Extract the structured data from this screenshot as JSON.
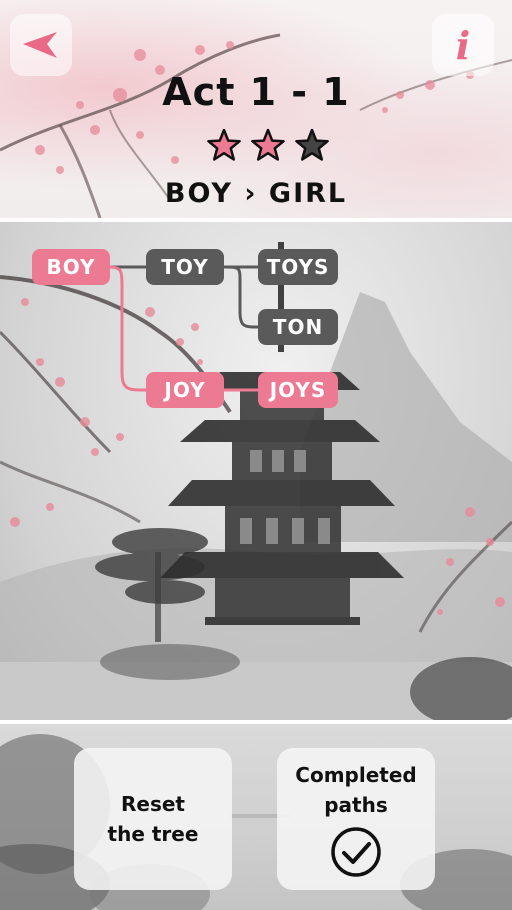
{
  "header": {
    "title": "Act 1 - 1",
    "subtitle": "BOY › GIRL",
    "stars": {
      "earned": 2,
      "total": 3
    },
    "back_icon": "back-arrow-icon",
    "info_icon": "info-icon",
    "info_glyph": "i"
  },
  "tree": {
    "nodes": {
      "boy": "BOY",
      "toy": "TOY",
      "toys": "TOYS",
      "ton": "TON",
      "joy": "JOY",
      "joys": "JOYS"
    }
  },
  "buttons": {
    "reset_label": "Reset\nthe tree",
    "completed_label": "Completed\npaths",
    "completed_icon": "checkmark-circle-icon"
  },
  "colors": {
    "accent_pink": "#ec7a92",
    "node_dark": "#5a5a5a",
    "star_empty": "#444444"
  }
}
